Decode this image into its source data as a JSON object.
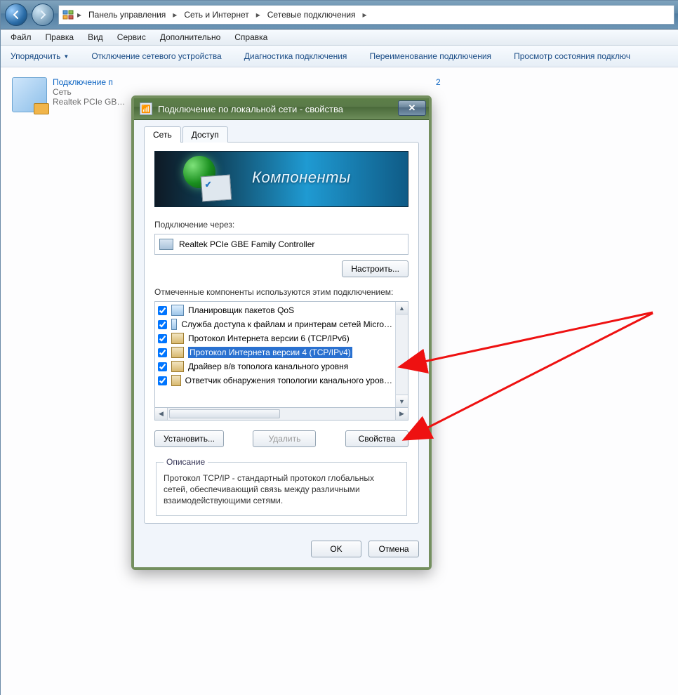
{
  "nav": {
    "breadcrumb": [
      "Панель управления",
      "Сеть и Интернет",
      "Сетевые подключения"
    ]
  },
  "menu": {
    "file": "Файл",
    "edit": "Правка",
    "view": "Вид",
    "tools": "Сервис",
    "advanced": "Дополнительно",
    "help": "Справка"
  },
  "commands": {
    "organize": "Упорядочить",
    "disable": "Отключение сетевого устройства",
    "diagnose": "Диагностика подключения",
    "rename": "Переименование подключения",
    "status": "Просмотр состояния подключ"
  },
  "connection_item": {
    "name": "Подключение п",
    "line2": "Сеть",
    "line3": "Realtek PCIe GB…"
  },
  "trailing_index": "2",
  "dialog": {
    "title": "Подключение по локальной сети - свойства",
    "tabs": {
      "network": "Сеть",
      "sharing": "Доступ"
    },
    "banner_label": "Компоненты",
    "connect_using_label": "Подключение через:",
    "adapter": "Realtek PCIe GBE Family Controller",
    "configure_btn": "Настроить...",
    "components_label": "Отмеченные компоненты используются этим подключением:",
    "components": [
      {
        "checked": true,
        "icon": "svc",
        "label": "Планировщик пакетов QoS"
      },
      {
        "checked": true,
        "icon": "svc",
        "label": "Служба доступа к файлам и принтерам сетей Micro…"
      },
      {
        "checked": true,
        "icon": "net",
        "label": "Протокол Интернета версии 6 (TCP/IPv6)"
      },
      {
        "checked": true,
        "icon": "net",
        "label": "Протокол Интернета версии 4 (TCP/IPv4)",
        "selected": true
      },
      {
        "checked": true,
        "icon": "net",
        "label": "Драйвер в/в тополога канального уровня"
      },
      {
        "checked": true,
        "icon": "net",
        "label": "Ответчик обнаружения топологии канального уров…"
      }
    ],
    "install_btn": "Установить...",
    "uninstall_btn": "Удалить",
    "properties_btn": "Свойства",
    "description_legend": "Описание",
    "description_text": "Протокол TCP/IP - стандартный протокол глобальных сетей, обеспечивающий связь между различными взаимодействующими сетями.",
    "ok_btn": "OK",
    "cancel_btn": "Отмена"
  }
}
